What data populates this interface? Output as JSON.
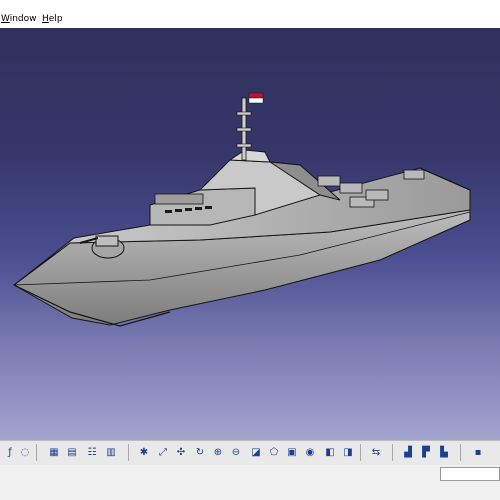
{
  "menubar": {
    "items": [
      {
        "prefix": "",
        "underlined": "W",
        "rest": "indow"
      },
      {
        "prefix": "",
        "underlined": "H",
        "rest": "elp"
      }
    ]
  },
  "colors": {
    "hull": "#a9a9a9",
    "hull_dark": "#6e6e6e",
    "flag_red": "#c8102e",
    "flag_white": "#ffffff",
    "edges": "#151515"
  },
  "toolbar": {
    "icons": [
      "formula-f-x-icon",
      "comment-bubble-icon",
      "tree-expand-icon",
      "table-icon",
      "tree-structure-icon",
      "catalog-icon",
      "properties-icon",
      "fit-all-in-icon",
      "pan-icon",
      "rotate-icon",
      "zoom-in-icon",
      "zoom-out-icon",
      "normal-view-icon",
      "iso-view-icon",
      "cube-view-icon",
      "shading-icon",
      "hide-show-icon",
      "swap-visible-space-icon",
      "measure-icon",
      "apply-material-icon",
      "render-icon",
      "print-icon"
    ]
  }
}
